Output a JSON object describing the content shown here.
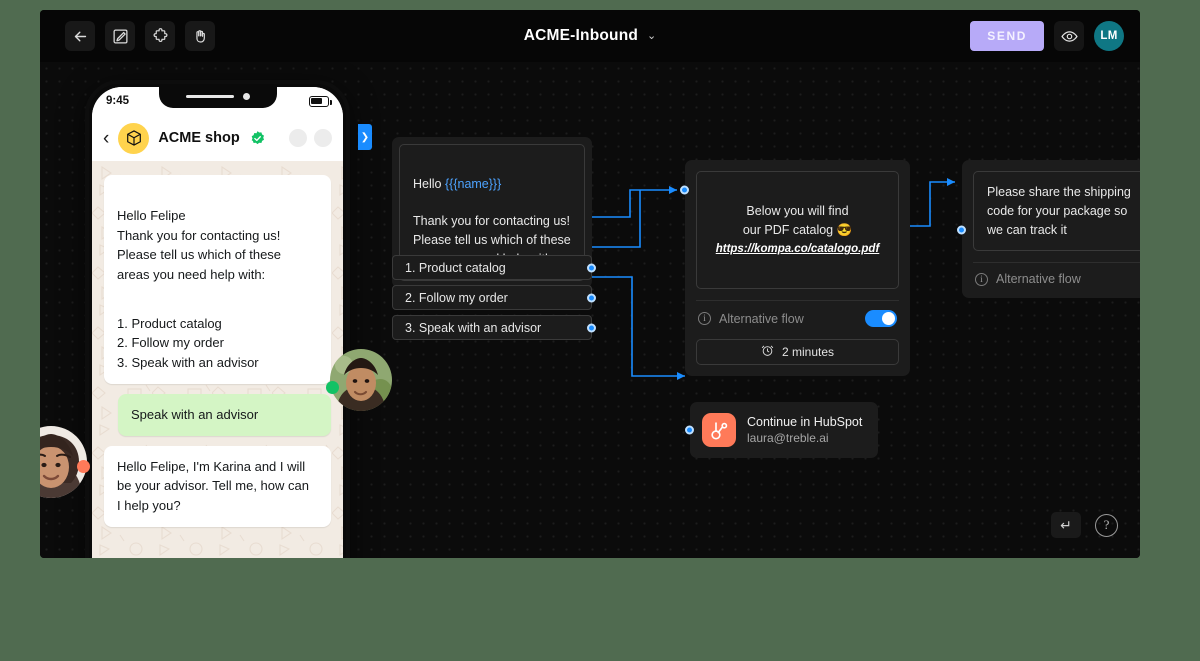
{
  "window": {
    "background_color": "#506b50",
    "app_background": "#0a0a0a"
  },
  "topbar": {
    "tools": [
      {
        "name": "back-icon",
        "label": "Back"
      },
      {
        "name": "edit-icon",
        "label": "Edit"
      },
      {
        "name": "puzzle-icon",
        "label": "Integrations"
      },
      {
        "name": "hand-icon",
        "label": "Pan"
      }
    ],
    "title": "ACME-Inbound",
    "title_caret": "⌄",
    "send_label": "SEND",
    "send_color": "#b7aaf8",
    "preview_icon": "eye-icon",
    "avatar_initials": "LM",
    "avatar_color": "#0f7784"
  },
  "phone": {
    "status_time": "9:45",
    "battery_icon": "battery-icon",
    "header": {
      "back_icon": "chevron-left-icon",
      "logo_icon": "box-icon",
      "logo_bg": "#ffd34d",
      "shop_name": "ACME shop",
      "verified_icon": "verified-badge-icon",
      "verified_color": "#12c265"
    },
    "messages": [
      {
        "direction": "in",
        "text": "Hello Felipe\nThank you for contacting us!\nPlease tell us which of these\nareas you need help with:",
        "options": "1. Product catalog\n2. Follow my order\n3. Speak with an advisor"
      },
      {
        "direction": "out",
        "text": "Speak with an advisor"
      },
      {
        "direction": "in",
        "text": "Hello Felipe, I'm Karina and I will\nbe your advisor. Tell me, how can\nI help you?"
      }
    ],
    "input_bar": {
      "emoji_icon": "emoji-circle-icon",
      "field_placeholder": "",
      "attach_icon": "attach-circle-icon",
      "camera_icon": "camera-circle-icon"
    }
  },
  "canvas": {
    "side_tab_icon": "chevron-right-icon",
    "accent_color": "#1a8cff",
    "avatars": [
      {
        "name": "avatar-karina",
        "status_color": "#ff7a59"
      },
      {
        "name": "avatar-felipe",
        "status_color": "#12c265"
      }
    ],
    "nodes": {
      "welcome": {
        "greeting_prefix": "Hello ",
        "greeting_var": "{{{name}}}",
        "body": "Thank you for contacting us!\nPlease tell us which of these\nareas you need help with:"
      },
      "options": [
        "1. Product catalog",
        "2. Follow my order",
        "3. Speak with an advisor"
      ],
      "catalog": {
        "text": "Below you will find\n  our PDF catalog  😎",
        "link": "https://kompa.co/catalogo.pdf",
        "alt_flow_label": "Alternative flow",
        "alt_flow_enabled": "on",
        "delay_icon": "alarm-clock-icon",
        "delay_label": "2 minutes"
      },
      "shipping": {
        "text": "Please share the shipping\ncode for your package so\nwe can track it",
        "alt_flow_label": "Alternative flow"
      },
      "hubspot": {
        "icon": "hubspot-icon",
        "icon_color": "#ff7a59",
        "title": "Continue in HubSpot",
        "subtitle": "laura@treble.ai"
      }
    },
    "controls": {
      "enter_icon": "enter-return-icon",
      "help_icon": "question-mark-icon"
    }
  }
}
